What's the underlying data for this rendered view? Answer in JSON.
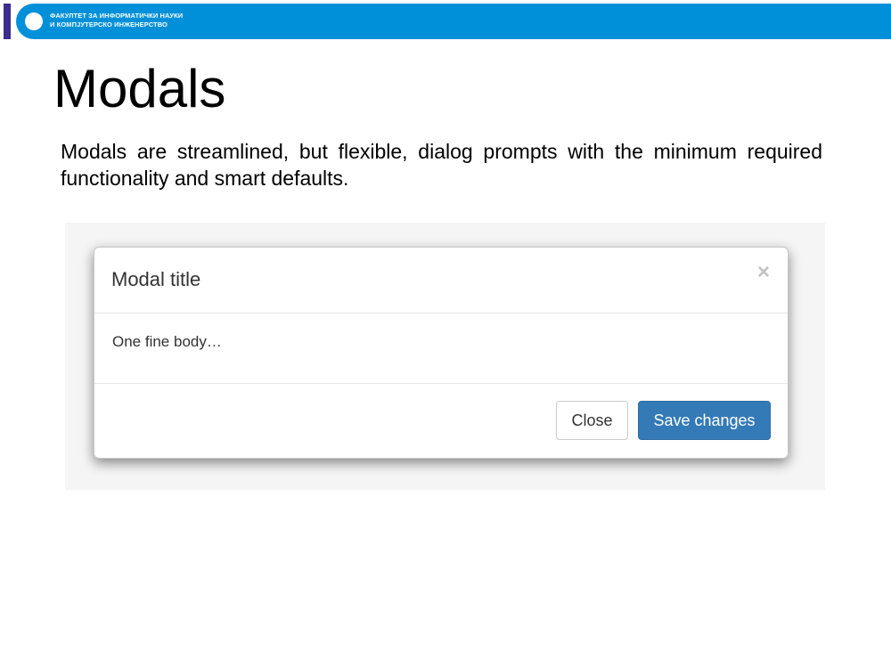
{
  "header": {
    "line1": "ФАКУЛТЕТ ЗА ИНФОРМАТИЧКИ НАУКИ",
    "line2": "И КОМПЈУТЕРСКО ИНЖЕНЕРСТВО",
    "logo_icon": "faculty-logo-circle-icon",
    "bar_color": "#0090d9",
    "accent_color": "#3c2d8f"
  },
  "slide": {
    "title": "Modals",
    "description": "Modals are streamlined, but flexible, dialog prompts with the minimum required functionality and smart defaults."
  },
  "modal": {
    "title": "Modal title",
    "close_symbol": "×",
    "close_icon": "close-icon",
    "body": "One fine body…",
    "buttons": {
      "close_label": "Close",
      "save_label": "Save changes"
    },
    "primary_color": "#337ab7"
  }
}
